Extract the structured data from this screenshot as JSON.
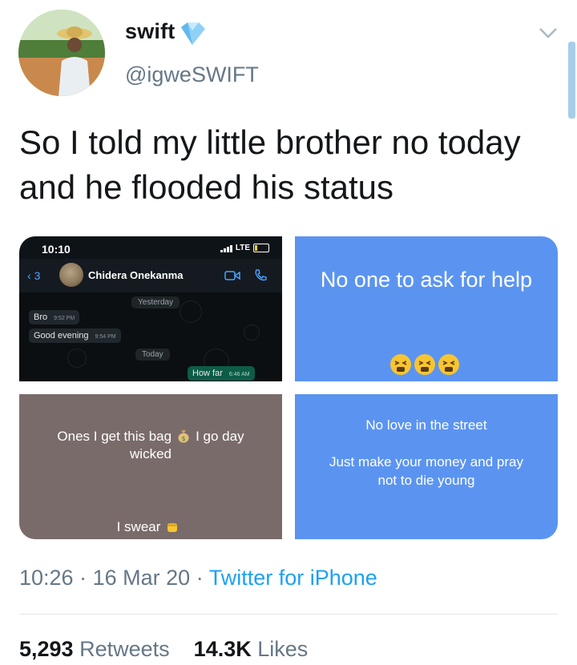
{
  "header": {
    "name": "swift",
    "handle": "@igweSWIFT"
  },
  "tweet": {
    "text": "So I told my little brother no today and he flooded his status"
  },
  "media": {
    "whatsapp": {
      "time": "10:10",
      "network": "LTE",
      "back_count": "3",
      "contact": "Chidera Onekanma",
      "day1": "Yesterday",
      "messages": [
        {
          "text": "Bro",
          "time": "9:52 PM"
        },
        {
          "text": "Good evening",
          "time": "9:54 PM"
        }
      ],
      "day2": "Today",
      "outgoing": {
        "text": "How far",
        "time": "6:46 AM"
      }
    },
    "status2": {
      "text": "No one to ask for help",
      "emoji_icon": "tired-face-emoji x3"
    },
    "status3": {
      "line1": "Ones I get this bag",
      "line1_tail": "I go day",
      "line2": "wicked",
      "footer": "I swear"
    },
    "status4": {
      "line1": "No love in the street",
      "line2": "Just make your money and pray",
      "line3": "not to die young"
    }
  },
  "footer": {
    "time": "10:26",
    "date": "16 Mar 20",
    "source": "Twitter for iPhone",
    "retweets_count": "5,293",
    "retweets_label": "Retweets",
    "likes_count": "14.3K",
    "likes_label": "Likes"
  },
  "colors": {
    "accent": "#1da1f2",
    "status_blue": "#5b94f0",
    "status_brown": "#7a6b6b"
  }
}
